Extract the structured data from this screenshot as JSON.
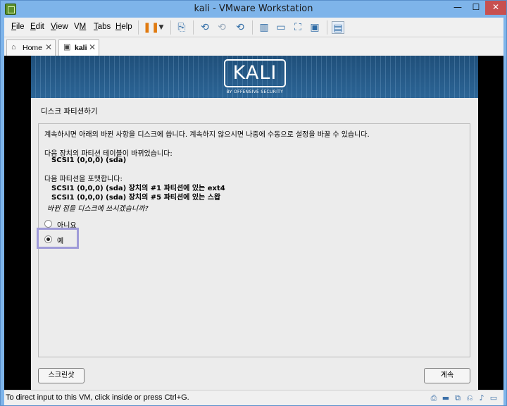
{
  "window": {
    "title": "kali - VMware Workstation",
    "minimize": "—",
    "maximize": "☐",
    "close": "✕"
  },
  "menu": {
    "file": {
      "key": "F",
      "rest": "ile"
    },
    "edit": {
      "key": "E",
      "rest": "dit"
    },
    "view": {
      "key": "V",
      "rest": "iew"
    },
    "vm": {
      "pre": "V",
      "key": "M",
      "rest": ""
    },
    "tabs": {
      "key": "T",
      "rest": "abs"
    },
    "help": {
      "key": "H",
      "rest": "elp"
    }
  },
  "tabs": [
    {
      "label": "Home",
      "close": "✕"
    },
    {
      "label": "kali",
      "close": "✕"
    }
  ],
  "installer": {
    "logo_text": "KALI",
    "logo_tagline": "BY OFFENSIVE SECURITY",
    "section_title": "디스크 파티션하기",
    "intro": "계속하시면 아래의 바뀐 사항을 디스크에 씁니다. 계속하지 않으시면 나중에 수동으로 설정을 바꿀 수 있습니다.",
    "table_changed_heading": "다음 장치의 파티션 테이블이 바뀌었습니다:",
    "table_changed_device": "SCSI1 (0,0,0) (sda)",
    "format_heading": "다음 파티션을 포맷합니다:",
    "format_item_1": "SCSI1 (0,0,0) (sda) 장치의 #1 파티션에 있는 ext4",
    "format_item_2": "SCSI1 (0,0,0) (sda) 장치의 #5 파티션에 있는 스왑",
    "question": "바뀐 점을 디스크에 쓰시겠습니까?",
    "options": [
      {
        "label": "아니요",
        "selected": false
      },
      {
        "label": "예",
        "selected": true
      }
    ],
    "screenshot_button": "스크린샷",
    "continue_button": "계속"
  },
  "status_bar": {
    "text": "To direct input to this VM, click inside or press Ctrl+G."
  }
}
